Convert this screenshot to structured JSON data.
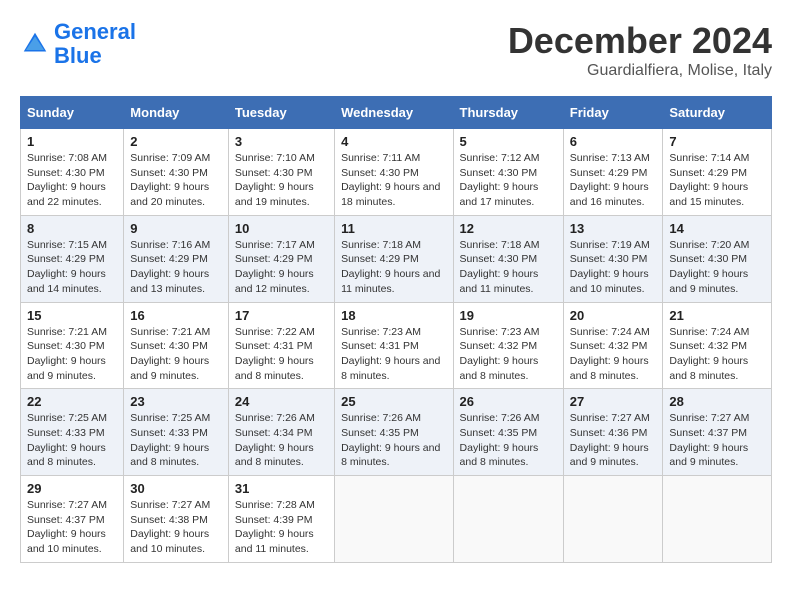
{
  "header": {
    "logo_line1": "General",
    "logo_line2": "Blue",
    "month": "December 2024",
    "location": "Guardialfiera, Molise, Italy"
  },
  "days_of_week": [
    "Sunday",
    "Monday",
    "Tuesday",
    "Wednesday",
    "Thursday",
    "Friday",
    "Saturday"
  ],
  "weeks": [
    [
      {
        "day": "1",
        "sunrise": "7:08 AM",
        "sunset": "4:30 PM",
        "daylight": "9 hours and 22 minutes."
      },
      {
        "day": "2",
        "sunrise": "7:09 AM",
        "sunset": "4:30 PM",
        "daylight": "9 hours and 20 minutes."
      },
      {
        "day": "3",
        "sunrise": "7:10 AM",
        "sunset": "4:30 PM",
        "daylight": "9 hours and 19 minutes."
      },
      {
        "day": "4",
        "sunrise": "7:11 AM",
        "sunset": "4:30 PM",
        "daylight": "9 hours and 18 minutes."
      },
      {
        "day": "5",
        "sunrise": "7:12 AM",
        "sunset": "4:30 PM",
        "daylight": "9 hours and 17 minutes."
      },
      {
        "day": "6",
        "sunrise": "7:13 AM",
        "sunset": "4:29 PM",
        "daylight": "9 hours and 16 minutes."
      },
      {
        "day": "7",
        "sunrise": "7:14 AM",
        "sunset": "4:29 PM",
        "daylight": "9 hours and 15 minutes."
      }
    ],
    [
      {
        "day": "8",
        "sunrise": "7:15 AM",
        "sunset": "4:29 PM",
        "daylight": "9 hours and 14 minutes."
      },
      {
        "day": "9",
        "sunrise": "7:16 AM",
        "sunset": "4:29 PM",
        "daylight": "9 hours and 13 minutes."
      },
      {
        "day": "10",
        "sunrise": "7:17 AM",
        "sunset": "4:29 PM",
        "daylight": "9 hours and 12 minutes."
      },
      {
        "day": "11",
        "sunrise": "7:18 AM",
        "sunset": "4:29 PM",
        "daylight": "9 hours and 11 minutes."
      },
      {
        "day": "12",
        "sunrise": "7:18 AM",
        "sunset": "4:30 PM",
        "daylight": "9 hours and 11 minutes."
      },
      {
        "day": "13",
        "sunrise": "7:19 AM",
        "sunset": "4:30 PM",
        "daylight": "9 hours and 10 minutes."
      },
      {
        "day": "14",
        "sunrise": "7:20 AM",
        "sunset": "4:30 PM",
        "daylight": "9 hours and 9 minutes."
      }
    ],
    [
      {
        "day": "15",
        "sunrise": "7:21 AM",
        "sunset": "4:30 PM",
        "daylight": "9 hours and 9 minutes."
      },
      {
        "day": "16",
        "sunrise": "7:21 AM",
        "sunset": "4:30 PM",
        "daylight": "9 hours and 9 minutes."
      },
      {
        "day": "17",
        "sunrise": "7:22 AM",
        "sunset": "4:31 PM",
        "daylight": "9 hours and 8 minutes."
      },
      {
        "day": "18",
        "sunrise": "7:23 AM",
        "sunset": "4:31 PM",
        "daylight": "9 hours and 8 minutes."
      },
      {
        "day": "19",
        "sunrise": "7:23 AM",
        "sunset": "4:32 PM",
        "daylight": "9 hours and 8 minutes."
      },
      {
        "day": "20",
        "sunrise": "7:24 AM",
        "sunset": "4:32 PM",
        "daylight": "9 hours and 8 minutes."
      },
      {
        "day": "21",
        "sunrise": "7:24 AM",
        "sunset": "4:32 PM",
        "daylight": "9 hours and 8 minutes."
      }
    ],
    [
      {
        "day": "22",
        "sunrise": "7:25 AM",
        "sunset": "4:33 PM",
        "daylight": "9 hours and 8 minutes."
      },
      {
        "day": "23",
        "sunrise": "7:25 AM",
        "sunset": "4:33 PM",
        "daylight": "9 hours and 8 minutes."
      },
      {
        "day": "24",
        "sunrise": "7:26 AM",
        "sunset": "4:34 PM",
        "daylight": "9 hours and 8 minutes."
      },
      {
        "day": "25",
        "sunrise": "7:26 AM",
        "sunset": "4:35 PM",
        "daylight": "9 hours and 8 minutes."
      },
      {
        "day": "26",
        "sunrise": "7:26 AM",
        "sunset": "4:35 PM",
        "daylight": "9 hours and 8 minutes."
      },
      {
        "day": "27",
        "sunrise": "7:27 AM",
        "sunset": "4:36 PM",
        "daylight": "9 hours and 9 minutes."
      },
      {
        "day": "28",
        "sunrise": "7:27 AM",
        "sunset": "4:37 PM",
        "daylight": "9 hours and 9 minutes."
      }
    ],
    [
      {
        "day": "29",
        "sunrise": "7:27 AM",
        "sunset": "4:37 PM",
        "daylight": "9 hours and 10 minutes."
      },
      {
        "day": "30",
        "sunrise": "7:27 AM",
        "sunset": "4:38 PM",
        "daylight": "9 hours and 10 minutes."
      },
      {
        "day": "31",
        "sunrise": "7:28 AM",
        "sunset": "4:39 PM",
        "daylight": "9 hours and 11 minutes."
      },
      null,
      null,
      null,
      null
    ]
  ]
}
